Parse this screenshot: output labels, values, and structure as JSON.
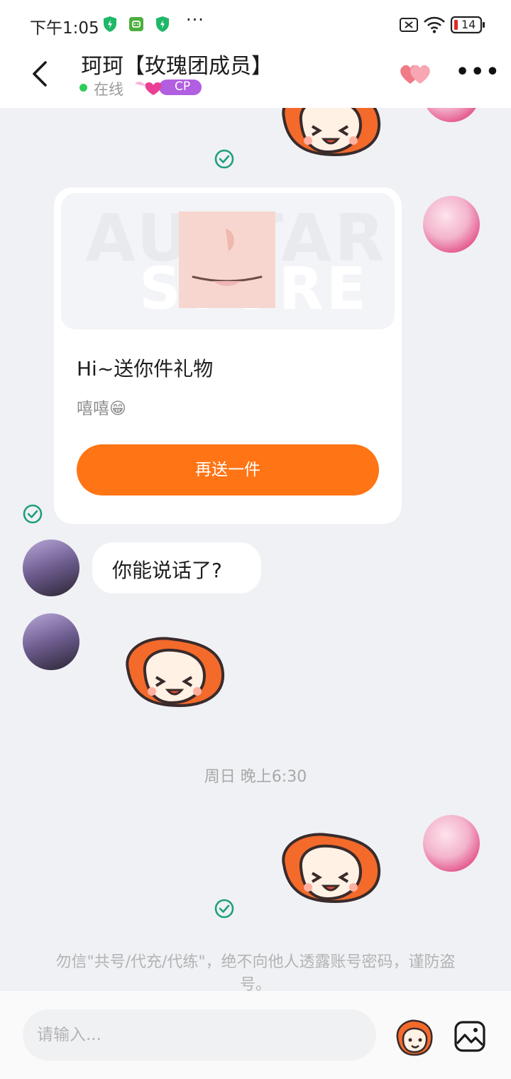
{
  "status_bar": {
    "time": "下午1:05",
    "more_dots": "···",
    "battery": "14"
  },
  "header": {
    "title": "珂珂【玫瑰团成员】",
    "status": "在线",
    "cp_label": "CP",
    "more": "•••"
  },
  "gift_card": {
    "watermark_top": "AUATAR",
    "watermark_bottom": "STORE",
    "title": "Hi~送你件礼物",
    "subtitle": "嘻嘻😁",
    "button": "再送一件"
  },
  "messages": {
    "text_bubble": "你能说话了?",
    "timestamp": "周日 晚上6:30",
    "notice": "勿信\"共号/代充/代练\"，绝不向他人透露账号密码，谨防盗号。"
  },
  "input": {
    "placeholder": "请输入..."
  },
  "colors": {
    "accent": "#ff7414",
    "online": "#2fcc5a",
    "read_check": "#1f9e7e",
    "background": "#eff1f5"
  }
}
